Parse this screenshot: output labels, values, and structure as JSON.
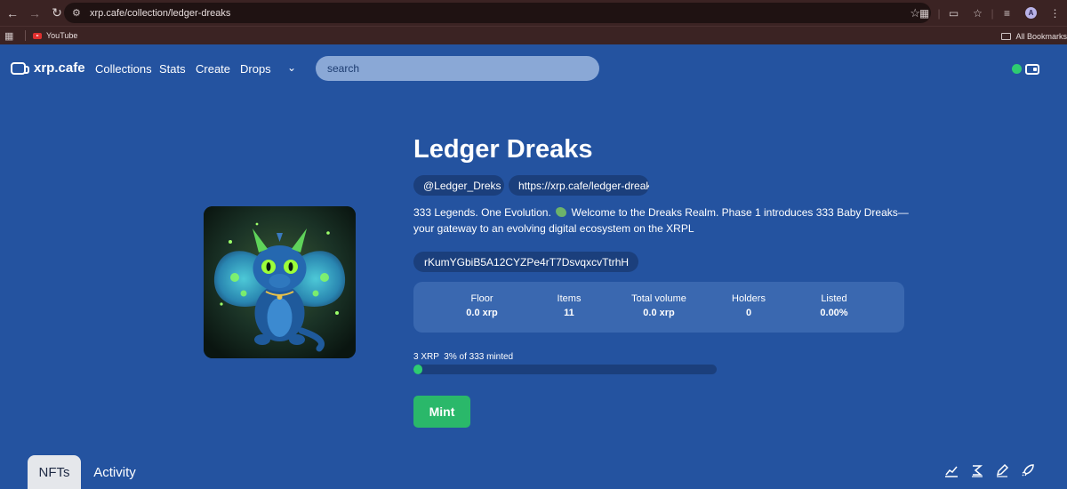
{
  "browser": {
    "url": "xrp.cafe/collection/ledger-dreaks",
    "bookmark_youtube": "YouTube",
    "all_bookmarks": "All Bookmarks",
    "profile_initial": "A"
  },
  "nav": {
    "logo": "xrp.cafe",
    "links": [
      "Collections",
      "Stats",
      "Create",
      "Drops"
    ],
    "search_placeholder": "search"
  },
  "collection": {
    "title": "Ledger Dreaks",
    "handle": "@Ledger_Dreks",
    "link": "https://xrp.cafe/ledger-dreaks",
    "description_part1": "333 Legends. One Evolution.",
    "description_part2": "Welcome to the Dreaks Realm. Phase 1 introduces 333 Baby Dreaks—your gateway to an evolving digital ecosystem on the XRPL",
    "address": "rKumYGbiB5A12CYZPe4rT7DsvqxcvTtrhH"
  },
  "stats": [
    {
      "label": "Floor",
      "value": "0.0 xrp"
    },
    {
      "label": "Items",
      "value": "11"
    },
    {
      "label": "Total volume",
      "value": "0.0 xrp"
    },
    {
      "label": "Holders",
      "value": "0"
    },
    {
      "label": "Listed",
      "value": "0.00%"
    }
  ],
  "mint": {
    "status": "3 XRP  3% of 333 minted",
    "progress_fraction": 0.03,
    "button": "Mint"
  },
  "tabs": [
    "NFTs",
    "Activity"
  ],
  "tools": [
    "chart-icon",
    "sweep-icon",
    "edit-icon",
    "rocket-icon"
  ],
  "colors": {
    "background": "#2453a0",
    "accent_green": "#2ab86a"
  }
}
